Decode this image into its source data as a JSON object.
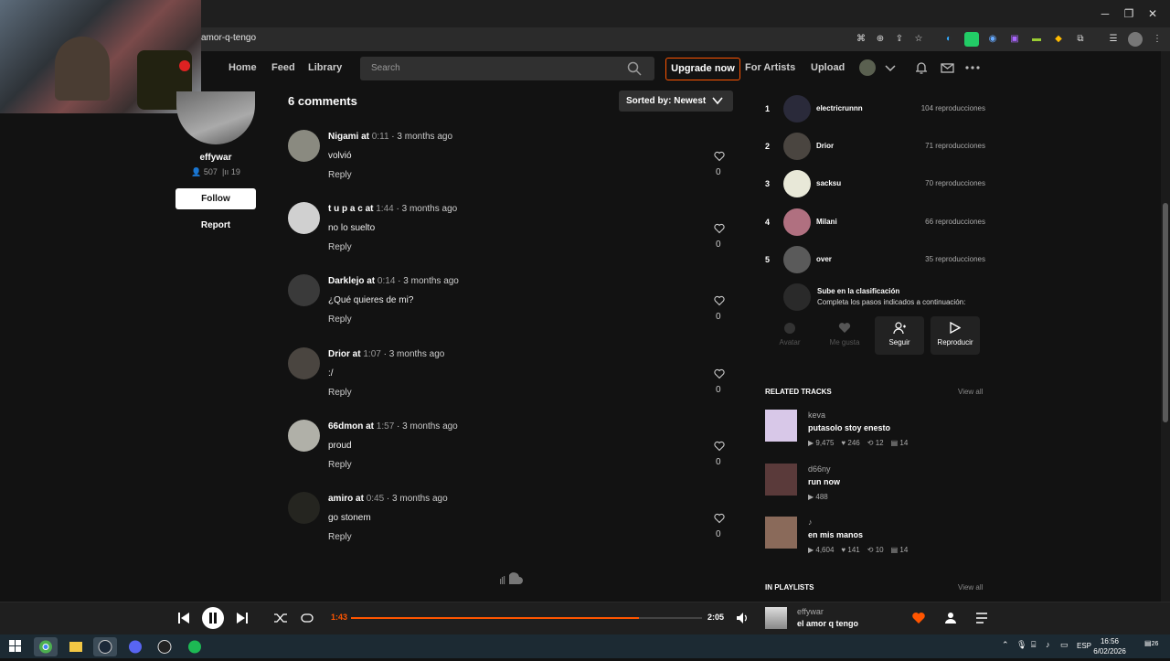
{
  "browser": {
    "url": "amor-q-tengo"
  },
  "header": {
    "nav": [
      "Home",
      "Feed",
      "Library"
    ],
    "search_placeholder": "Search",
    "upgrade_label": "Upgrade now",
    "for_artists_label": "For Artists",
    "upload_label": "Upload"
  },
  "artist": {
    "name": "effywar",
    "followers": "507",
    "tracks": "19",
    "follow_label": "Follow",
    "report_label": "Report"
  },
  "comments": {
    "title": "6 comments",
    "sort_label": "Sorted by: Newest",
    "reply_label": "Reply",
    "items": [
      {
        "user": "Nigami",
        "at": " at ",
        "time": "0:11",
        "ago": " · 3 months ago",
        "text": "volvió",
        "likes": "0",
        "color": "#8a8a80"
      },
      {
        "user": "t u p a c",
        "at": " at ",
        "time": "1:44",
        "ago": " · 3 months ago",
        "text": "no lo suelto",
        "likes": "0",
        "color": "#d0d0d0"
      },
      {
        "user": "Darklejo",
        "at": " at ",
        "time": "0:14",
        "ago": " · 3 months ago",
        "text": "¿Qué quieres de mi?",
        "likes": "0",
        "color": "#3a3a3a"
      },
      {
        "user": "Drior",
        "at": " at ",
        "time": "1:07",
        "ago": " · 3 months ago",
        "text": ":/",
        "likes": "0",
        "color": "#4a4540"
      },
      {
        "user": "66dmon",
        "at": " at ",
        "time": "1:57",
        "ago": " · 3 months ago",
        "text": "proud",
        "likes": "0",
        "color": "#b0b0a8"
      },
      {
        "user": "amiro",
        "at": " at ",
        "time": "0:45",
        "ago": " · 3 months ago",
        "text": "go stonem",
        "likes": "0",
        "color": "#252520"
      }
    ]
  },
  "ranking": {
    "items": [
      {
        "rank": "1",
        "name": "electricrunnn",
        "plays": "104 reproducciones",
        "color": "#2a2a3a"
      },
      {
        "rank": "2",
        "name": "Drior",
        "plays": "71 reproducciones",
        "color": "#4a4540"
      },
      {
        "rank": "3",
        "name": "sacksu",
        "plays": "70 reproducciones",
        "color": "#e8e8d8"
      },
      {
        "rank": "4",
        "name": "Milani",
        "plays": "66 reproducciones",
        "color": "#b07080"
      },
      {
        "rank": "5",
        "name": "over",
        "plays": "35 reproducciones",
        "color": "#5a5a5a"
      }
    ],
    "cta_title": "Sube en la clasificación",
    "cta_sub": "Completa los pasos indicados a continuación:",
    "cta_buttons": [
      "Avatar",
      "Me gusta",
      "Seguir",
      "Reproducir"
    ]
  },
  "related": {
    "title": "RELATED TRACKS",
    "view_all": "View all",
    "tracks": [
      {
        "artist": "keva",
        "title": "putasolo stoy enesto",
        "plays": "9,475",
        "likes": "246",
        "reposts": "12",
        "comments": "14",
        "color": "#d8c8e8"
      },
      {
        "artist": "d66ny",
        "title": "run now",
        "plays": "488",
        "likes": "",
        "reposts": "",
        "comments": "",
        "color": "#5a3a3a"
      },
      {
        "artist": "♪",
        "title": "en mis manos",
        "plays": "4,604",
        "likes": "141",
        "reposts": "10",
        "comments": "14",
        "color": "#8a6a5a"
      }
    ]
  },
  "playlists": {
    "title": "IN PLAYLISTS",
    "view_all": "View all"
  },
  "player": {
    "current": "1:43",
    "total": "2:05",
    "progress": 0.82,
    "artist": "effywar",
    "title": "el amor q tengo"
  },
  "taskbar": {
    "lang": "ESP",
    "time": "16:56",
    "date": "6/02/2026",
    "notifications": "26"
  },
  "colors": {
    "accent": "#ff5500",
    "bg": "#121212"
  }
}
